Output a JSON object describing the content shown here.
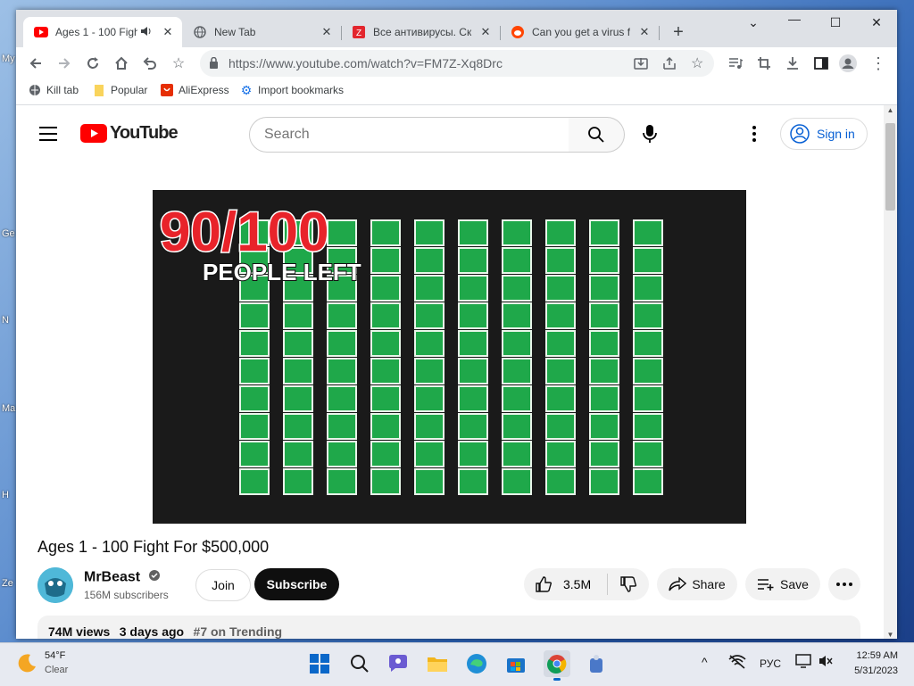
{
  "tabs": [
    {
      "title": "Ages 1 - 100 Figh",
      "active": true
    },
    {
      "title": "New Tab"
    },
    {
      "title": "Все антивирусы. Ска"
    },
    {
      "title": "Can you get a virus fr"
    }
  ],
  "address": {
    "url": "https://www.youtube.com/watch?v=FM7Z-Xq8Drc"
  },
  "bookmarks": [
    "Kill tab",
    "Popular",
    "AliExpress",
    "Import bookmarks"
  ],
  "youtube": {
    "logo_text": "YouTube",
    "search_placeholder": "Search",
    "signin_label": "Sign in",
    "video": {
      "thumbnail_headline": "90/100",
      "thumbnail_sub": "PEOPLE LEFT",
      "title": "Ages 1 - 100 Fight For $500,000",
      "channel": "MrBeast",
      "subscribers": "156M subscribers",
      "join_label": "Join",
      "subscribe_label": "Subscribe",
      "likes": "3.5M",
      "share_label": "Share",
      "save_label": "Save",
      "views": "74M views",
      "age": "3 days ago",
      "trending": "#7 on Trending"
    }
  },
  "taskbar": {
    "weather_temp": "54°F",
    "weather_desc": "Clear",
    "language": "РУС",
    "time": "12:59 AM",
    "date": "5/31/2023"
  },
  "colors": {
    "youtube_red": "#ff0000",
    "link_blue": "#065fd4",
    "grass_green": "#1fa84a"
  }
}
